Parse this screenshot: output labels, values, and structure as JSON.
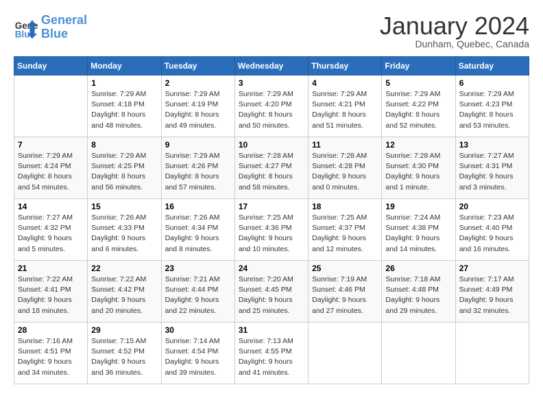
{
  "header": {
    "logo_line1": "General",
    "logo_line2": "Blue",
    "title": "January 2024",
    "location": "Dunham, Quebec, Canada"
  },
  "columns": [
    "Sunday",
    "Monday",
    "Tuesday",
    "Wednesday",
    "Thursday",
    "Friday",
    "Saturday"
  ],
  "weeks": [
    [
      {
        "day": "",
        "info": ""
      },
      {
        "day": "1",
        "info": "Sunrise: 7:29 AM\nSunset: 4:18 PM\nDaylight: 8 hours\nand 48 minutes."
      },
      {
        "day": "2",
        "info": "Sunrise: 7:29 AM\nSunset: 4:19 PM\nDaylight: 8 hours\nand 49 minutes."
      },
      {
        "day": "3",
        "info": "Sunrise: 7:29 AM\nSunset: 4:20 PM\nDaylight: 8 hours\nand 50 minutes."
      },
      {
        "day": "4",
        "info": "Sunrise: 7:29 AM\nSunset: 4:21 PM\nDaylight: 8 hours\nand 51 minutes."
      },
      {
        "day": "5",
        "info": "Sunrise: 7:29 AM\nSunset: 4:22 PM\nDaylight: 8 hours\nand 52 minutes."
      },
      {
        "day": "6",
        "info": "Sunrise: 7:29 AM\nSunset: 4:23 PM\nDaylight: 8 hours\nand 53 minutes."
      }
    ],
    [
      {
        "day": "7",
        "info": "Sunrise: 7:29 AM\nSunset: 4:24 PM\nDaylight: 8 hours\nand 54 minutes."
      },
      {
        "day": "8",
        "info": "Sunrise: 7:29 AM\nSunset: 4:25 PM\nDaylight: 8 hours\nand 56 minutes."
      },
      {
        "day": "9",
        "info": "Sunrise: 7:29 AM\nSunset: 4:26 PM\nDaylight: 8 hours\nand 57 minutes."
      },
      {
        "day": "10",
        "info": "Sunrise: 7:28 AM\nSunset: 4:27 PM\nDaylight: 8 hours\nand 58 minutes."
      },
      {
        "day": "11",
        "info": "Sunrise: 7:28 AM\nSunset: 4:28 PM\nDaylight: 9 hours\nand 0 minutes."
      },
      {
        "day": "12",
        "info": "Sunrise: 7:28 AM\nSunset: 4:30 PM\nDaylight: 9 hours\nand 1 minute."
      },
      {
        "day": "13",
        "info": "Sunrise: 7:27 AM\nSunset: 4:31 PM\nDaylight: 9 hours\nand 3 minutes."
      }
    ],
    [
      {
        "day": "14",
        "info": "Sunrise: 7:27 AM\nSunset: 4:32 PM\nDaylight: 9 hours\nand 5 minutes."
      },
      {
        "day": "15",
        "info": "Sunrise: 7:26 AM\nSunset: 4:33 PM\nDaylight: 9 hours\nand 6 minutes."
      },
      {
        "day": "16",
        "info": "Sunrise: 7:26 AM\nSunset: 4:34 PM\nDaylight: 9 hours\nand 8 minutes."
      },
      {
        "day": "17",
        "info": "Sunrise: 7:25 AM\nSunset: 4:36 PM\nDaylight: 9 hours\nand 10 minutes."
      },
      {
        "day": "18",
        "info": "Sunrise: 7:25 AM\nSunset: 4:37 PM\nDaylight: 9 hours\nand 12 minutes."
      },
      {
        "day": "19",
        "info": "Sunrise: 7:24 AM\nSunset: 4:38 PM\nDaylight: 9 hours\nand 14 minutes."
      },
      {
        "day": "20",
        "info": "Sunrise: 7:23 AM\nSunset: 4:40 PM\nDaylight: 9 hours\nand 16 minutes."
      }
    ],
    [
      {
        "day": "21",
        "info": "Sunrise: 7:22 AM\nSunset: 4:41 PM\nDaylight: 9 hours\nand 18 minutes."
      },
      {
        "day": "22",
        "info": "Sunrise: 7:22 AM\nSunset: 4:42 PM\nDaylight: 9 hours\nand 20 minutes."
      },
      {
        "day": "23",
        "info": "Sunrise: 7:21 AM\nSunset: 4:44 PM\nDaylight: 9 hours\nand 22 minutes."
      },
      {
        "day": "24",
        "info": "Sunrise: 7:20 AM\nSunset: 4:45 PM\nDaylight: 9 hours\nand 25 minutes."
      },
      {
        "day": "25",
        "info": "Sunrise: 7:19 AM\nSunset: 4:46 PM\nDaylight: 9 hours\nand 27 minutes."
      },
      {
        "day": "26",
        "info": "Sunrise: 7:18 AM\nSunset: 4:48 PM\nDaylight: 9 hours\nand 29 minutes."
      },
      {
        "day": "27",
        "info": "Sunrise: 7:17 AM\nSunset: 4:49 PM\nDaylight: 9 hours\nand 32 minutes."
      }
    ],
    [
      {
        "day": "28",
        "info": "Sunrise: 7:16 AM\nSunset: 4:51 PM\nDaylight: 9 hours\nand 34 minutes."
      },
      {
        "day": "29",
        "info": "Sunrise: 7:15 AM\nSunset: 4:52 PM\nDaylight: 9 hours\nand 36 minutes."
      },
      {
        "day": "30",
        "info": "Sunrise: 7:14 AM\nSunset: 4:54 PM\nDaylight: 9 hours\nand 39 minutes."
      },
      {
        "day": "31",
        "info": "Sunrise: 7:13 AM\nSunset: 4:55 PM\nDaylight: 9 hours\nand 41 minutes."
      },
      {
        "day": "",
        "info": ""
      },
      {
        "day": "",
        "info": ""
      },
      {
        "day": "",
        "info": ""
      }
    ]
  ]
}
